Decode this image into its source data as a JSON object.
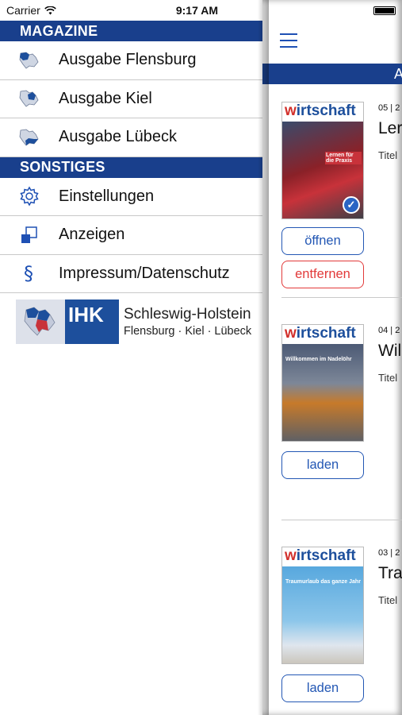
{
  "status_bar": {
    "carrier": "Carrier",
    "time": "9:17 AM"
  },
  "drawer": {
    "sections": [
      {
        "title": "MAGAZINE",
        "items": [
          {
            "label": "Ausgabe Flensburg",
            "icon": "map-flensburg-icon"
          },
          {
            "label": "Ausgabe Kiel",
            "icon": "map-kiel-icon"
          },
          {
            "label": "Ausgabe Lübeck",
            "icon": "map-luebeck-icon"
          }
        ]
      },
      {
        "title": "SONSTIGES",
        "items": [
          {
            "label": "Einstellungen",
            "icon": "gear-icon"
          },
          {
            "label": "Anzeigen",
            "icon": "ads-icon"
          },
          {
            "label": "Impressum/Datenschutz",
            "icon": "paragraph-icon"
          }
        ]
      }
    ],
    "logo": {
      "abbr": "IHK",
      "line1": "Schleswig-Holstein",
      "line2": "Flensburg · Kiel · Lübeck"
    }
  },
  "pane": {
    "header_text": "A",
    "cover_brand_w": "w",
    "cover_brand_rest": "irtschaft",
    "issues": [
      {
        "meta": "05 | 2",
        "title": "Ler",
        "sub": "Titel",
        "cover_caption": "Lernen für die Praxis",
        "buttons": [
          "öffnen",
          "entfernen"
        ],
        "downloaded": true
      },
      {
        "meta": "04 | 2",
        "title": "Wil",
        "sub": "Titel",
        "cover_caption": "Willkommen im Nadelöhr",
        "buttons": [
          "laden"
        ],
        "downloaded": false
      },
      {
        "meta": "03 | 2",
        "title": "Tra",
        "sub": "Titel",
        "cover_caption": "Traumurlaub das ganze Jahr",
        "buttons": [
          "laden"
        ],
        "downloaded": false
      }
    ]
  },
  "colors": {
    "section_header": "#193f8c",
    "accent_blue": "#2357b4",
    "danger_red": "#e23a3a",
    "brand_red": "#d2302b"
  }
}
